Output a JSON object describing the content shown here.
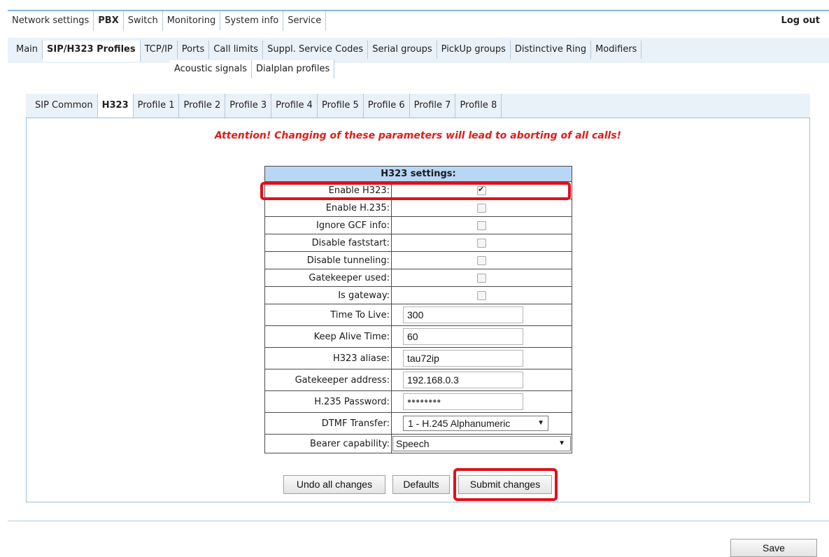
{
  "top_nav": {
    "tabs": [
      {
        "label": "Network settings"
      },
      {
        "label": "PBX"
      },
      {
        "label": "Switch"
      },
      {
        "label": "Monitoring"
      },
      {
        "label": "System info"
      },
      {
        "label": "Service"
      }
    ],
    "active": "PBX",
    "logout": "Log out"
  },
  "sub_nav": {
    "tabs": [
      {
        "label": "Main"
      },
      {
        "label": "SIP/H323 Profiles"
      },
      {
        "label": "TCP/IP"
      },
      {
        "label": "Ports"
      },
      {
        "label": "Call limits"
      },
      {
        "label": "Suppl. Service Codes"
      },
      {
        "label": "Serial groups"
      },
      {
        "label": "PickUp groups"
      },
      {
        "label": "Distinctive Ring"
      },
      {
        "label": "Modifiers"
      },
      {
        "label": "Acoustic signals"
      },
      {
        "label": "Dialplan profiles"
      }
    ],
    "active": "SIP/H323 Profiles"
  },
  "profile_tabs": {
    "tabs": [
      {
        "label": "SIP Common"
      },
      {
        "label": "H323"
      },
      {
        "label": "Profile 1"
      },
      {
        "label": "Profile 2"
      },
      {
        "label": "Profile 3"
      },
      {
        "label": "Profile 4"
      },
      {
        "label": "Profile 5"
      },
      {
        "label": "Profile 6"
      },
      {
        "label": "Profile 7"
      },
      {
        "label": "Profile 8"
      }
    ],
    "active": "H323"
  },
  "attention": "Attention! Changing of these parameters will lead to aborting of all calls!",
  "settings": {
    "title": "H323 settings:",
    "checkboxes": [
      {
        "label": "Enable H323:",
        "checked": true
      },
      {
        "label": "Enable H.235:",
        "checked": false
      },
      {
        "label": "Ignore GCF info:",
        "checked": false
      },
      {
        "label": "Disable faststart:",
        "checked": false
      },
      {
        "label": "Disable tunneling:",
        "checked": false
      },
      {
        "label": "Gatekeeper used:",
        "checked": false
      },
      {
        "label": "Is gateway:",
        "checked": false
      }
    ],
    "inputs": [
      {
        "label": "Time To Live:",
        "value": "300"
      },
      {
        "label": "Keep Alive Time:",
        "value": "60"
      },
      {
        "label": "H323 aliase:",
        "value": "tau72ip"
      },
      {
        "label": "Gatekeeper address:",
        "value": "192.168.0.3"
      },
      {
        "label": "H.235 Password:",
        "value": "●●●●●●●●"
      }
    ],
    "dtmf": {
      "label": "DTMF Transfer:",
      "value": "1 - H.245 Alphanumeric"
    },
    "bearer": {
      "label": "Bearer capability:",
      "value": "Speech"
    }
  },
  "buttons": {
    "undo": "Undo all changes",
    "defaults": "Defaults",
    "submit": "Submit changes",
    "save": "Save"
  },
  "colors": {
    "attention": "#e21b1b",
    "header_bg": "#b8d7f5",
    "highlight": "#e0101a",
    "tab_strip": "#e9f1f9"
  }
}
